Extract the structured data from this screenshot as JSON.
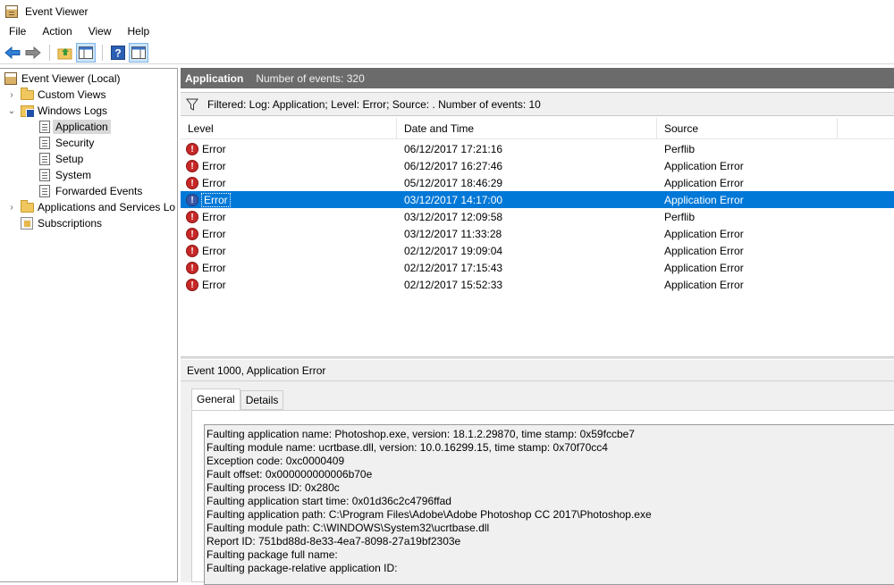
{
  "window": {
    "title": "Event Viewer"
  },
  "menu": [
    "File",
    "Action",
    "View",
    "Help"
  ],
  "toolbar": {
    "buttons": [
      "back-arrow-icon",
      "forward-arrow-icon",
      "up-folder-icon",
      "show-hide-tree-icon",
      "help-icon",
      "show-hide-action-pane-icon"
    ]
  },
  "tree": {
    "root": "Event Viewer (Local)",
    "custom_views": "Custom Views",
    "windows_logs": "Windows Logs",
    "application": "Application",
    "security": "Security",
    "setup": "Setup",
    "system": "System",
    "forwarded_events": "Forwarded Events",
    "apps_services": "Applications and Services Lo",
    "subscriptions": "Subscriptions"
  },
  "header": {
    "title": "Application",
    "count": "Number of events: 320"
  },
  "filter": {
    "text": "Filtered: Log: Application; Level: Error; Source: . Number of events: 10"
  },
  "grid": {
    "columns": {
      "level": "Level",
      "date": "Date and Time",
      "source": "Source"
    },
    "rows": [
      {
        "level": "Error",
        "date": "06/12/2017 17:21:16",
        "source": "Perflib"
      },
      {
        "level": "Error",
        "date": "06/12/2017 16:27:46",
        "source": "Application Error"
      },
      {
        "level": "Error",
        "date": "05/12/2017 18:46:29",
        "source": "Application Error"
      },
      {
        "level": "Error",
        "date": "03/12/2017 14:17:00",
        "source": "Application Error"
      },
      {
        "level": "Error",
        "date": "03/12/2017 12:09:58",
        "source": "Perflib"
      },
      {
        "level": "Error",
        "date": "03/12/2017 11:33:28",
        "source": "Application Error"
      },
      {
        "level": "Error",
        "date": "02/12/2017 19:09:04",
        "source": "Application Error"
      },
      {
        "level": "Error",
        "date": "02/12/2017 17:15:43",
        "source": "Application Error"
      },
      {
        "level": "Error",
        "date": "02/12/2017 15:52:33",
        "source": "Application Error"
      }
    ],
    "selected_index": 3
  },
  "detail": {
    "title": "Event 1000, Application Error",
    "tabs": {
      "general": "General",
      "details": "Details"
    },
    "lines": [
      "Faulting application name: Photoshop.exe, version: 18.1.2.29870, time stamp: 0x59fccbe7",
      "Faulting module name: ucrtbase.dll, version: 10.0.16299.15, time stamp: 0x70f70cc4",
      "Exception code: 0xc0000409",
      "Fault offset: 0x000000000006b70e",
      "Faulting process ID: 0x280c",
      "Faulting application start time: 0x01d36c2c4796ffad",
      "Faulting application path: C:\\Program Files\\Adobe\\Adobe Photoshop CC 2017\\Photoshop.exe",
      "Faulting module path: C:\\WINDOWS\\System32\\ucrtbase.dll",
      "Report ID: 751bd88d-8e33-4ea7-8098-27a19bf2303e",
      "Faulting package full name:",
      "Faulting package-relative application ID:"
    ]
  },
  "colors": {
    "selection": "#0078d7",
    "header_bar": "#6b6b6b",
    "error": "#c62828"
  }
}
